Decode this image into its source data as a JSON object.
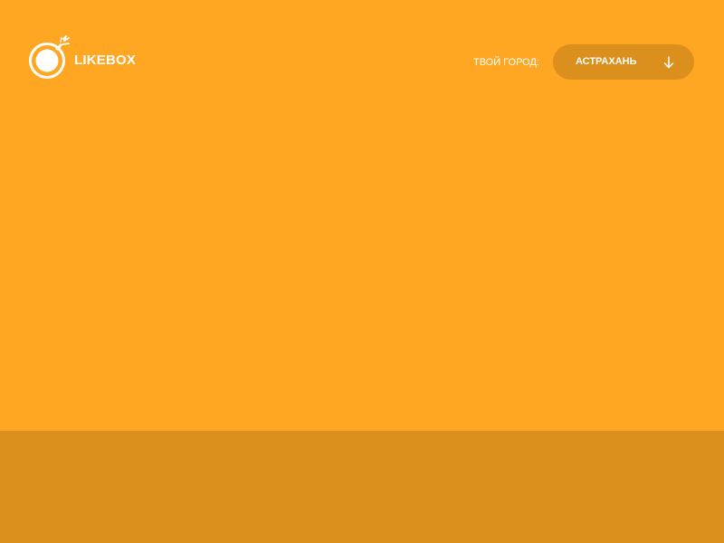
{
  "colors": {
    "background": "#FFA722",
    "accent_dark": "#DB8F1C",
    "text": "#FFFFFF"
  },
  "header": {
    "logo": {
      "icon": "bomb-icon",
      "text": "LIKEBOX"
    },
    "city_label": "ТВОЙ ГОРОД:",
    "city_select": {
      "value": "АСТРАХАНЬ",
      "icon": "arrow-down-icon"
    }
  }
}
